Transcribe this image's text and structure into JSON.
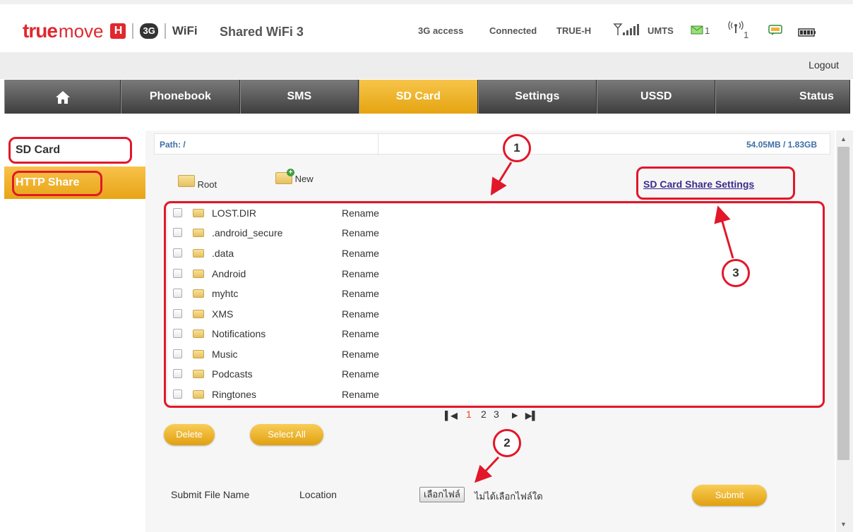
{
  "header": {
    "logo_true": "true",
    "logo_move": "move",
    "logo_h": "H",
    "logo_3g": "3G",
    "logo_wifi": "WiFi",
    "product": "Shared WiFi 3",
    "access": "3G access",
    "connection": "Connected",
    "operator": "TRUE-H",
    "network": "UMTS",
    "sms_count": "1",
    "wifi_clients": "1",
    "icons": [
      "signal-icon",
      "envelope-icon",
      "wifi-clients-icon",
      "message-icon",
      "battery-icon"
    ]
  },
  "logout": "Logout",
  "nav": {
    "home_icon": "home-icon",
    "items": [
      "Phonebook",
      "SMS",
      "SD Card",
      "Settings",
      "USSD",
      "Status"
    ],
    "active": "SD Card"
  },
  "sidebar": {
    "items": [
      "SD Card",
      "HTTP Share"
    ]
  },
  "main": {
    "path_label": "Path: /",
    "capacity": "54.05MB / 1.83GB",
    "root_label": "Root",
    "new_label": "New",
    "share_settings": "SD Card Share Settings",
    "rename_label": "Rename",
    "files": [
      ".",
      "LOST.DIR",
      ".android_secure",
      ".data",
      "Android",
      "myhtc",
      "XMS",
      "Notifications",
      "Music",
      "Podcasts",
      "Ringtones"
    ],
    "pages": [
      "1",
      "2",
      "3"
    ],
    "current_page": "1",
    "delete_btn": "Delete",
    "select_all_btn": "Select All",
    "submit_file_name": "Submit File Name",
    "location": "Location",
    "choose_file": "เลือกไฟล์",
    "no_file": "ไม่ได้เลือกไฟล์ใด",
    "submit_btn": "Submit"
  },
  "annotations": [
    "1",
    "2",
    "3"
  ],
  "colors": {
    "accent": "#e5a411",
    "nav_dark": "#3e3e3e",
    "highlight": "#e2172a",
    "link": "#3b2a8c"
  }
}
